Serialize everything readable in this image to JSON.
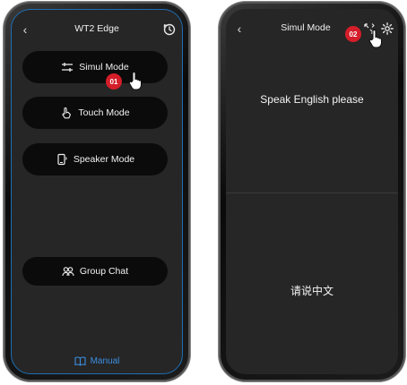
{
  "left_phone": {
    "header": {
      "title": "WT2 Edge"
    },
    "modes": [
      {
        "label": "Simul Mode",
        "icon": "sliders-icon"
      },
      {
        "label": "Touch Mode",
        "icon": "touch-hand-icon"
      },
      {
        "label": "Speaker Mode",
        "icon": "phone-speaker-icon"
      },
      {
        "label": "Group Chat",
        "icon": "group-icon"
      }
    ],
    "step_badge": "01",
    "manual_label": "Manual"
  },
  "right_phone": {
    "header": {
      "title": "Simul Mode"
    },
    "step_badge": "02",
    "prompt_top": "Speak English please",
    "prompt_bottom": "请说中文"
  },
  "colors": {
    "accent": "#3b8ee0",
    "badge": "#d41e2a",
    "screen_bg": "#262626",
    "button_bg": "#0b0b0b"
  }
}
